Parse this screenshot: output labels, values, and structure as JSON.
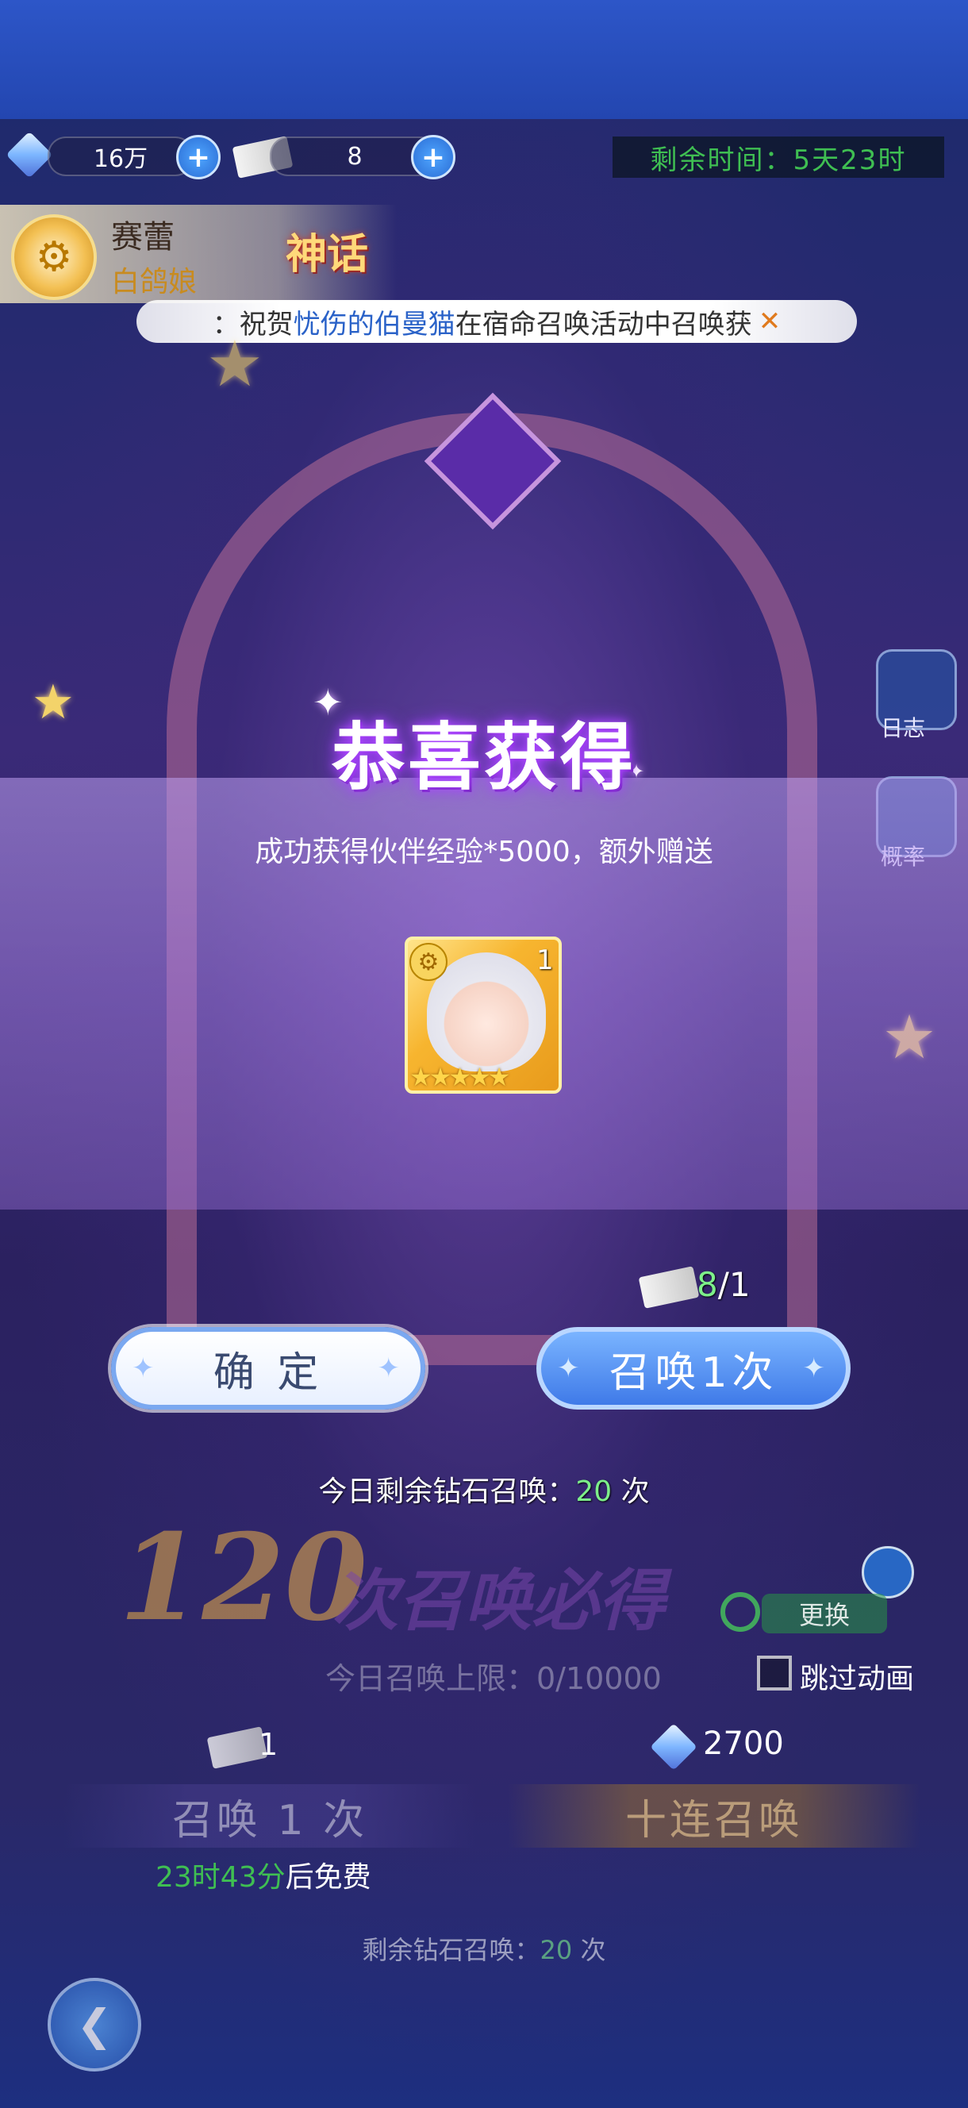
{
  "resources": {
    "gems": "16万",
    "tickets": "8",
    "plus": "+"
  },
  "timer": "剩余时间：5天23时",
  "hero": {
    "name": "赛蕾",
    "title": "白鸽娘",
    "rarity": "神话"
  },
  "marquee": {
    "prefix": "：祝贺",
    "player": "忧伤的伯曼猫",
    "suffix": "在宿命召唤活动中召唤获",
    "close": "✕"
  },
  "side": {
    "log": "日志",
    "rate": "概率"
  },
  "popup": {
    "title": "恭喜获得",
    "message": "成功获得伙伴经验*5000，额外赠送",
    "reward_count": "1",
    "reward_stars": "★★★★★"
  },
  "cost": {
    "have": "8",
    "need": "/1"
  },
  "buttons": {
    "confirm": "确 定",
    "summon_once": "召唤1次"
  },
  "daily": {
    "label": "今日剩余钻石召唤：",
    "count": "20",
    "unit": " 次"
  },
  "banner": {
    "number": "120",
    "text": "次召唤必得"
  },
  "change_label": "更换",
  "today_limit": "今日召唤上限：0/10000",
  "skip_label": "跳过动画",
  "summon_costs": {
    "single": "1",
    "ten": "2700"
  },
  "summon_buttons": {
    "single": "召唤 1 次",
    "ten": "十连召唤"
  },
  "free": {
    "time": "23时43分",
    "suffix": "后免费"
  },
  "gem_left": {
    "label": "剩余钻石召唤：",
    "count": "20",
    "unit": " 次"
  },
  "colors": {
    "accent_green": "#7df08a",
    "summon_blue": "#3f7ae8",
    "topbar": "#2346b0"
  }
}
